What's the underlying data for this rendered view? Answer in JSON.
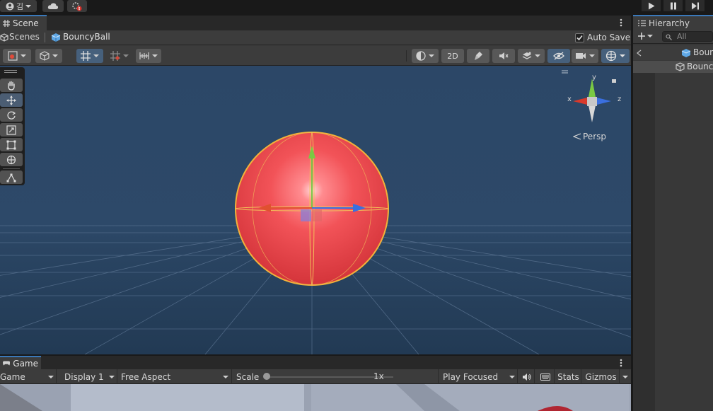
{
  "topbar": {
    "account_label": "김",
    "cloud": "cloud-icon",
    "collab": "collab-icon"
  },
  "play_controls": [
    "play-icon",
    "pause-icon",
    "step-icon"
  ],
  "scene": {
    "tab_label": "Scene",
    "breadcrumb_scenes": "Scenes",
    "breadcrumb_object": "BouncyBall",
    "auto_save_label": "Auto Save",
    "auto_save_checked": true,
    "toolbar": {
      "mode_2d": "2D"
    },
    "persp_label": "Persp",
    "gizmo_axes": {
      "x": "x",
      "y": "y",
      "z": "z"
    }
  },
  "tools": [
    "hand-icon",
    "move-icon",
    "rotate-icon",
    "scale-icon",
    "rect-icon",
    "transform-icon",
    "custom-tool-icon"
  ],
  "game": {
    "tab_label": "Game",
    "dropdown_game": "Game",
    "display": "Display 1",
    "aspect": "Free Aspect",
    "scale_label": "Scale",
    "scale_value": "1x",
    "scale_fraction": 0.0,
    "play_focused": "Play Focused",
    "stats": "Stats",
    "gizmos": "Gizmos"
  },
  "hierarchy": {
    "tab_label": "Hierarchy",
    "search_placeholder": "All",
    "scene_item": "BouncyBall",
    "child_item": "BouncyBall"
  },
  "colors": {
    "scene_bg": "#2b4766",
    "accent": "#3a79bb",
    "ball": "#e8474c",
    "axis_x": "#d83a2c",
    "axis_y": "#7ac943",
    "axis_z": "#3a6fe0"
  }
}
